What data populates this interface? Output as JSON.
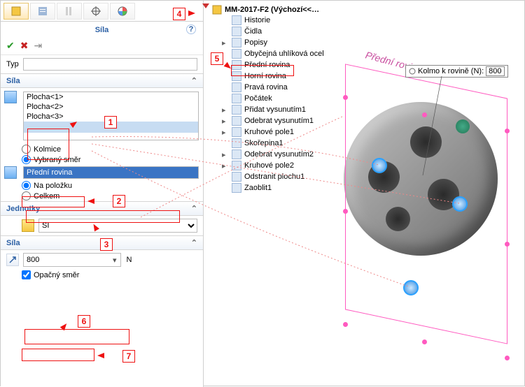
{
  "header": {
    "title": "Síla",
    "help_symbol": "?"
  },
  "type_row": {
    "label": "Typ",
    "value": ""
  },
  "section_sila": {
    "label": "Síla",
    "faces": [
      "Plocha<1>",
      "Plocha<2>",
      "Plocha<3>"
    ],
    "radio_kolmice": "Kolmice",
    "radio_vybrany": "Vybraný směr",
    "selected_direction": "Přední rovina",
    "radio_na_polozku": "Na položku",
    "radio_celkem": "Celkem"
  },
  "section_jednotky": {
    "label": "Jednotky",
    "value": "SI"
  },
  "section_sila2": {
    "label": "Síla",
    "value": "800",
    "unit": "N",
    "dropdown": "▾",
    "opacny": "Opačný směr"
  },
  "tree": {
    "root": "MM-2017-F2  (Výchozí<<…",
    "items": [
      "Historie",
      "Čidla",
      "Popisy",
      "Obyčejná uhlíková ocel",
      "Přední rovina",
      "Horní rovina",
      "Pravá rovina",
      "Počátek",
      "Přidat vysunutím1",
      "Odebrat vysunutím1",
      "Kruhové pole1",
      "Skořepina1",
      "Odebrat vysunutím2",
      "Kruhové pole2",
      "Odstranit plochu1",
      "Zaoblit1"
    ]
  },
  "canvas": {
    "plane_label": "Přední rovina",
    "tooltip_label": "Kolmo k rovině (N):",
    "tooltip_value": "800"
  },
  "callouts": {
    "c1": "1",
    "c2": "2",
    "c3": "3",
    "c4": "4",
    "c5": "5",
    "c6": "6",
    "c7": "7"
  }
}
